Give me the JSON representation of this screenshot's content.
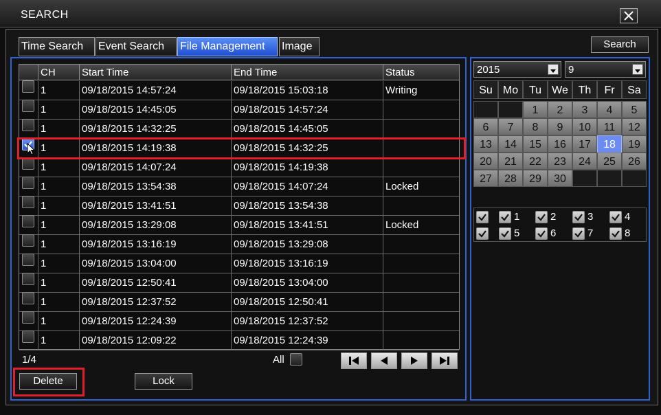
{
  "window": {
    "title": "SEARCH"
  },
  "tabs": [
    {
      "label": "Time Search",
      "active": false
    },
    {
      "label": "Event Search",
      "active": false
    },
    {
      "label": "File Management",
      "active": true
    },
    {
      "label": "Image",
      "active": false
    }
  ],
  "search_button": "Search",
  "table": {
    "columns": [
      "CH",
      "Start Time",
      "End Time",
      "Status"
    ],
    "rows": [
      {
        "checked": false,
        "ch": "1",
        "start": "09/18/2015 14:57:24",
        "end": "09/18/2015 15:03:18",
        "status": "Writing"
      },
      {
        "checked": false,
        "ch": "1",
        "start": "09/18/2015 14:45:05",
        "end": "09/18/2015 14:57:24",
        "status": ""
      },
      {
        "checked": false,
        "ch": "1",
        "start": "09/18/2015 14:32:25",
        "end": "09/18/2015 14:45:05",
        "status": ""
      },
      {
        "checked": true,
        "ch": "1",
        "start": "09/18/2015 14:19:38",
        "end": "09/18/2015 14:32:25",
        "status": ""
      },
      {
        "checked": false,
        "ch": "1",
        "start": "09/18/2015 14:07:24",
        "end": "09/18/2015 14:19:38",
        "status": ""
      },
      {
        "checked": false,
        "ch": "1",
        "start": "09/18/2015 13:54:38",
        "end": "09/18/2015 14:07:24",
        "status": "Locked"
      },
      {
        "checked": false,
        "ch": "1",
        "start": "09/18/2015 13:41:51",
        "end": "09/18/2015 13:54:38",
        "status": ""
      },
      {
        "checked": false,
        "ch": "1",
        "start": "09/18/2015 13:29:08",
        "end": "09/18/2015 13:41:51",
        "status": "Locked"
      },
      {
        "checked": false,
        "ch": "1",
        "start": "09/18/2015 13:16:19",
        "end": "09/18/2015 13:29:08",
        "status": ""
      },
      {
        "checked": false,
        "ch": "1",
        "start": "09/18/2015 13:04:00",
        "end": "09/18/2015 13:16:19",
        "status": ""
      },
      {
        "checked": false,
        "ch": "1",
        "start": "09/18/2015 12:50:41",
        "end": "09/18/2015 13:04:00",
        "status": ""
      },
      {
        "checked": false,
        "ch": "1",
        "start": "09/18/2015 12:37:52",
        "end": "09/18/2015 12:50:41",
        "status": ""
      },
      {
        "checked": false,
        "ch": "1",
        "start": "09/18/2015 12:24:39",
        "end": "09/18/2015 12:37:52",
        "status": ""
      },
      {
        "checked": false,
        "ch": "1",
        "start": "09/18/2015 12:09:22",
        "end": "09/18/2015 12:24:39",
        "status": ""
      }
    ]
  },
  "pagination": {
    "page": "1/4",
    "all_label": "All"
  },
  "buttons": {
    "delete": "Delete",
    "lock": "Lock"
  },
  "calendar": {
    "year": "2015",
    "month": "9",
    "weekdays": [
      "Su",
      "Mo",
      "Tu",
      "We",
      "Th",
      "Fr",
      "Sa"
    ],
    "first_weekday_index": 2,
    "days_in_month": 30,
    "selected_day": 18
  },
  "channels": [
    {
      "label": "",
      "checked": true
    },
    {
      "label": "1",
      "checked": true
    },
    {
      "label": "2",
      "checked": true
    },
    {
      "label": "3",
      "checked": true
    },
    {
      "label": "4",
      "checked": true
    },
    {
      "label": "",
      "checked": true
    },
    {
      "label": "5",
      "checked": true
    },
    {
      "label": "6",
      "checked": true
    },
    {
      "label": "7",
      "checked": true
    },
    {
      "label": "8",
      "checked": true
    }
  ],
  "colors": {
    "accent_blue": "#2e62d6",
    "active_tab": "#3a6fe6",
    "highlight_red": "#e0202a",
    "selected_day": "#6c8cf2"
  }
}
